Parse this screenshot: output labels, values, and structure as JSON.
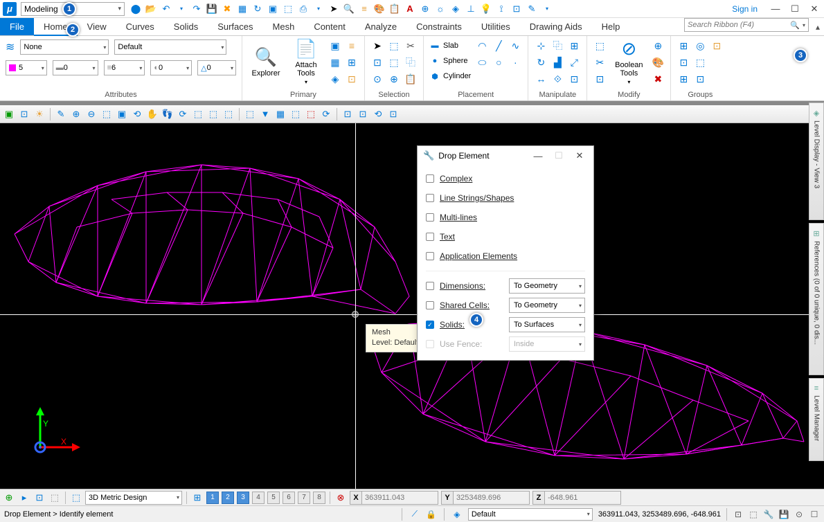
{
  "titlebar": {
    "workflow": "Modeling",
    "signin": "Sign in"
  },
  "menu": {
    "file": "File",
    "tabs": [
      "Home",
      "View",
      "Curves",
      "Solids",
      "Surfaces",
      "Mesh",
      "Content",
      "Analyze",
      "Constraints",
      "Utilities",
      "Drawing Aids",
      "Help"
    ],
    "search_placeholder": "Search Ribbon (F4)"
  },
  "ribbon": {
    "attributes": {
      "label": "Attributes",
      "layer_combo": "None",
      "style_combo": "Default",
      "color_val": "5",
      "weight_val": "0",
      "linestyle_val": "6",
      "shade_val": "0",
      "fill_val": "0"
    },
    "primary": {
      "label": "Primary",
      "explorer": "Explorer",
      "attach": "Attach Tools"
    },
    "selection": {
      "label": "Selection"
    },
    "placement": {
      "label": "Placement",
      "slab": "Slab",
      "sphere": "Sphere",
      "cylinder": "Cylinder"
    },
    "manipulate": {
      "label": "Manipulate"
    },
    "modify": {
      "label": "Modify",
      "boolean": "Boolean Tools"
    },
    "groups": {
      "label": "Groups"
    }
  },
  "dialog": {
    "title": "Drop Element",
    "complex": "Complex",
    "linestrings": "Line Strings/Shapes",
    "multilines": "Multi-lines",
    "text": "Text",
    "appel": "Application Elements",
    "dimensions": "Dimensions:",
    "dimensions_val": "To Geometry",
    "sharedcells": "Shared Cells:",
    "sharedcells_val": "To Geometry",
    "solids": "Solids:",
    "solids_val": "To Surfaces",
    "usefence": "Use Fence:",
    "usefence_val": "Inside"
  },
  "tooltip": {
    "line1": "Mesh",
    "line2": "Level: Default"
  },
  "sidetabs": {
    "leveldisplay": "Level Display - View 3",
    "references": "References (0 of 0 unique, 0 dis...",
    "levelmanager": "Level Manager"
  },
  "status1": {
    "model_combo": "3D Metric Design",
    "views_on": [
      "1",
      "2",
      "3"
    ],
    "views_off": [
      "4",
      "5",
      "6",
      "7",
      "8"
    ],
    "x_label": "X",
    "x_val": "363911.043",
    "y_label": "Y",
    "y_val": "3253489.696",
    "z_label": "Z",
    "z_val": "-648.961"
  },
  "status2": {
    "prompt": "Drop Element > Identify element",
    "level": "Default",
    "coords": "363911.043, 3253489.696, -648.961"
  },
  "callouts": {
    "c1": "1",
    "c2": "2",
    "c3": "3",
    "c4": "4"
  }
}
